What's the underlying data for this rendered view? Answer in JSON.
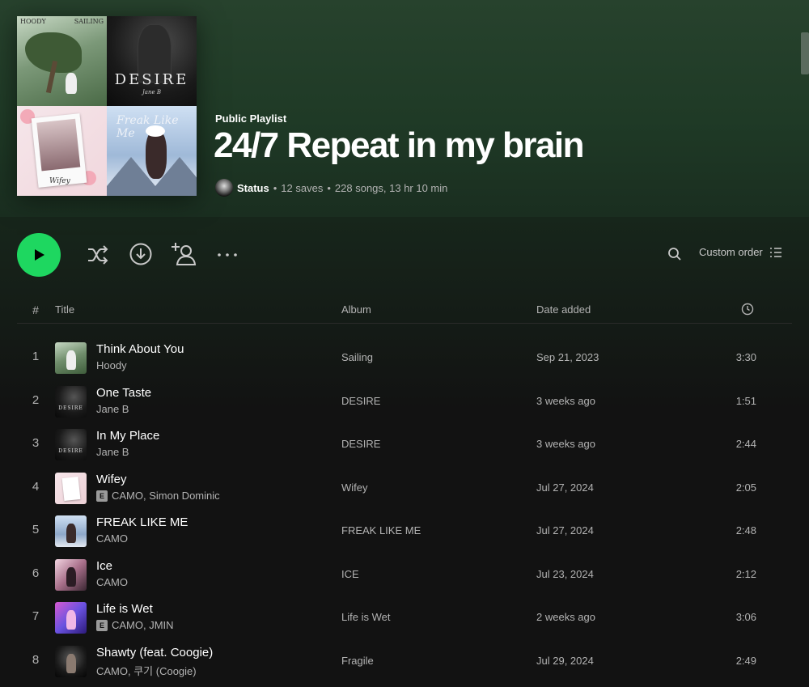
{
  "colors": {
    "accent": "#1ed760",
    "header_top": "#27422d",
    "background": "#121212",
    "text_secondary": "#b3b3b3"
  },
  "cover": {
    "tile_a_left": "HOODY",
    "tile_a_right": "SAILING",
    "tile_b_word": "DESIRE",
    "tile_b_sub": "Jane B",
    "tile_c_word": "Wifey",
    "tile_d_word": "Freak Like Me"
  },
  "playlist": {
    "type_label": "Public Playlist",
    "title": "24/7 Repeat in my brain",
    "owner": "Status",
    "separator": "•",
    "saves": "12 saves",
    "stats": "228 songs, 13 hr 10 min"
  },
  "actions": {
    "play_icon": "play-icon",
    "shuffle_icon": "shuffle-icon",
    "download_icon": "download-icon",
    "add_user_icon": "add-user-icon",
    "more_icon": "more-icon",
    "search_icon": "search-icon",
    "sort_label": "Custom order",
    "sort_icon": "list-icon"
  },
  "table": {
    "headers": {
      "number": "#",
      "title": "Title",
      "album": "Album",
      "date_added": "Date added",
      "duration_icon": "clock-icon"
    },
    "rows": [
      {
        "num": "1",
        "title": "Think About You",
        "artist": "Hoody",
        "explicit": false,
        "album": "Sailing",
        "date": "Sep 21, 2023",
        "duration": "3:30"
      },
      {
        "num": "2",
        "title": "One Taste",
        "artist": "Jane B",
        "explicit": false,
        "album": "DESIRE",
        "date": "3 weeks ago",
        "duration": "1:51"
      },
      {
        "num": "3",
        "title": "In My Place",
        "artist": "Jane B",
        "explicit": false,
        "album": "DESIRE",
        "date": "3 weeks ago",
        "duration": "2:44"
      },
      {
        "num": "4",
        "title": "Wifey",
        "artist": "CAMO, Simon Dominic",
        "explicit": true,
        "album": "Wifey",
        "date": "Jul 27, 2024",
        "duration": "2:05"
      },
      {
        "num": "5",
        "title": "FREAK LIKE ME",
        "artist": "CAMO",
        "explicit": false,
        "album": "FREAK LIKE ME",
        "date": "Jul 27, 2024",
        "duration": "2:48"
      },
      {
        "num": "6",
        "title": "Ice",
        "artist": "CAMO",
        "explicit": false,
        "album": "ICE",
        "date": "Jul 23, 2024",
        "duration": "2:12"
      },
      {
        "num": "7",
        "title": "Life is Wet",
        "artist": "CAMO, JMIN",
        "explicit": true,
        "album": "Life is Wet",
        "date": "2 weeks ago",
        "duration": "3:06"
      },
      {
        "num": "8",
        "title": "Shawty (feat. Coogie)",
        "artist": "CAMO, 쿠기 (Coogie)",
        "explicit": false,
        "album": "Fragile",
        "date": "Jul 29, 2024",
        "duration": "2:49"
      }
    ],
    "explicit_label": "E"
  }
}
